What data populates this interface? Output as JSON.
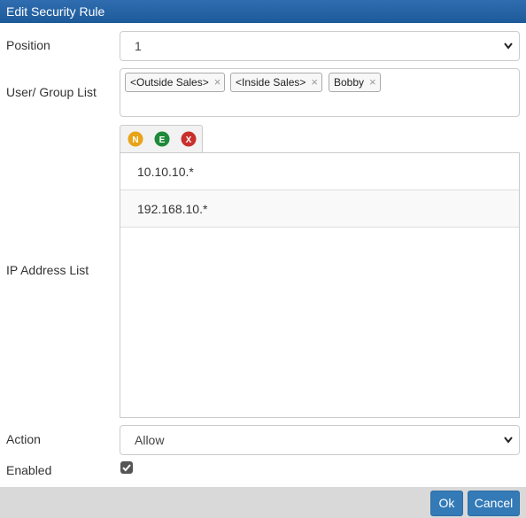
{
  "dialog": {
    "title": "Edit Security Rule"
  },
  "position": {
    "label": "Position",
    "value": "1"
  },
  "user_group": {
    "label": "User/ Group List",
    "tags": [
      "<Outside Sales>",
      "<Inside Sales>",
      "Bobby"
    ],
    "remove_glyph": "×"
  },
  "ip": {
    "label": "IP Address List",
    "toolbar": [
      {
        "letter": "N",
        "color": "#e8a317",
        "icon": "new-icon"
      },
      {
        "letter": "E",
        "color": "#1e8a3a",
        "icon": "edit-icon"
      },
      {
        "letter": "X",
        "color": "#c9302c",
        "icon": "delete-icon"
      }
    ],
    "addresses": [
      "10.10.10.*",
      "192.168.10.*"
    ]
  },
  "action": {
    "label": "Action",
    "value": "Allow"
  },
  "enabled": {
    "label": "Enabled",
    "checked": true
  },
  "footer": {
    "ok_label": "Ok",
    "cancel_label": "Cancel"
  },
  "colors": {
    "accent": "#337ab7",
    "title_bar": "#2366a8"
  }
}
